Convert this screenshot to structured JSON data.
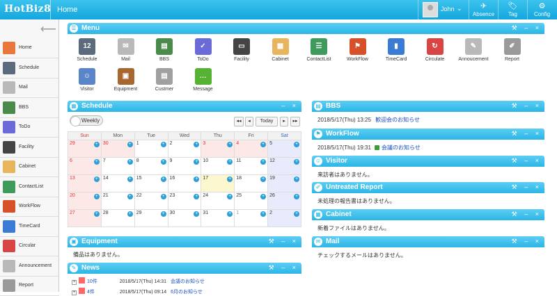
{
  "topbar": {
    "logo": "HotBiz8",
    "home_label": "Home",
    "user_name": "John",
    "buttons": [
      {
        "label": "Absence",
        "icon": "absence-icon",
        "glyph": "✈"
      },
      {
        "label": "Tag",
        "icon": "tag-icon",
        "glyph": "🏷"
      },
      {
        "label": "Config",
        "icon": "config-icon",
        "glyph": "⚙"
      }
    ]
  },
  "sidebar": {
    "items": [
      {
        "label": "Home",
        "icon": "home-icon",
        "color": "#e8783c"
      },
      {
        "label": "Schedule",
        "icon": "schedule-icon",
        "color": "#5b6a7d"
      },
      {
        "label": "Mail",
        "icon": "mail-icon",
        "color": "#b9b9b9"
      },
      {
        "label": "BBS",
        "icon": "bbs-icon",
        "color": "#4a8a4a"
      },
      {
        "label": "ToDo",
        "icon": "todo-icon",
        "color": "#6a6ad8"
      },
      {
        "label": "Facility",
        "icon": "facility-icon",
        "color": "#444444"
      },
      {
        "label": "Cabinet",
        "icon": "cabinet-icon",
        "color": "#e8b55c"
      },
      {
        "label": "ContactList",
        "icon": "contactlist-icon",
        "color": "#3f9b5b"
      },
      {
        "label": "WorkFlow",
        "icon": "workflow-icon",
        "color": "#d8502a"
      },
      {
        "label": "TimeCard",
        "icon": "timecard-icon",
        "color": "#3a7bd5"
      },
      {
        "label": "Circular",
        "icon": "circular-icon",
        "color": "#d94545"
      },
      {
        "label": "Announcement",
        "icon": "announcement-icon",
        "color": "#b9b9b9"
      },
      {
        "label": "Report",
        "icon": "report-icon",
        "color": "#9a9a9a"
      }
    ]
  },
  "menu_panel": {
    "title": "Menu",
    "items": [
      {
        "label": "Schedule",
        "icon": "schedule-icon",
        "color": "#5b6a7d",
        "glyph": "12"
      },
      {
        "label": "Mail",
        "icon": "mail-icon",
        "color": "#b9b9b9",
        "glyph": "✉"
      },
      {
        "label": "BBS",
        "icon": "bbs-icon",
        "color": "#4a8a4a",
        "glyph": "▤"
      },
      {
        "label": "ToDo",
        "icon": "todo-icon",
        "color": "#6a6ad8",
        "glyph": "✓"
      },
      {
        "label": "Facility",
        "icon": "facility-icon",
        "color": "#444444",
        "glyph": "▭"
      },
      {
        "label": "Cabinet",
        "icon": "cabinet-icon",
        "color": "#e8b55c",
        "glyph": "▦"
      },
      {
        "label": "ContactList",
        "icon": "contactlist-icon",
        "color": "#3f9b5b",
        "glyph": "☰"
      },
      {
        "label": "WorkFlow",
        "icon": "workflow-icon",
        "color": "#d8502a",
        "glyph": "⚑"
      },
      {
        "label": "TimeCard",
        "icon": "timecard-icon",
        "color": "#3a7bd5",
        "glyph": "▮"
      },
      {
        "label": "Circulate",
        "icon": "circulate-icon",
        "color": "#d94545",
        "glyph": "↻"
      },
      {
        "label": "Annoucement",
        "icon": "announcement-icon",
        "color": "#b9b9b9",
        "glyph": "✎"
      },
      {
        "label": "Report",
        "icon": "report-icon",
        "color": "#9a9a9a",
        "glyph": "✐"
      },
      {
        "label": "Visitor",
        "icon": "visitor-icon",
        "color": "#5a86c9",
        "glyph": "☺"
      },
      {
        "label": "Equipment",
        "icon": "equipment-icon",
        "color": "#a8672e",
        "glyph": "▣"
      },
      {
        "label": "Custmer",
        "icon": "customer-icon",
        "color": "#a0a0a0",
        "glyph": "▤"
      },
      {
        "label": "Message",
        "icon": "message-icon",
        "color": "#56b232",
        "glyph": "…"
      }
    ]
  },
  "schedule_panel": {
    "title": "Schedule",
    "weekly_label": "Weekly",
    "nav": {
      "prev2": "◂◂",
      "prev": "◂",
      "today": "Today",
      "next": "▸",
      "next2": "▸▸"
    },
    "weekdays": [
      "Sun",
      "Mon",
      "Tue",
      "Wed",
      "Thu",
      "Fri",
      "Sat"
    ],
    "weeks": [
      [
        "29",
        "30",
        "1",
        "2",
        "3",
        "4",
        "5"
      ],
      [
        "6",
        "7",
        "8",
        "9",
        "10",
        "11",
        "12"
      ],
      [
        "13",
        "14",
        "15",
        "16",
        "17",
        "18",
        "19"
      ],
      [
        "20",
        "21",
        "22",
        "23",
        "24",
        "25",
        "26"
      ],
      [
        "27",
        "28",
        "29",
        "30",
        "31",
        "1",
        "2"
      ]
    ],
    "holidays": [
      "3",
      "4",
      "5",
      "6"
    ],
    "today": "17"
  },
  "equipment_panel": {
    "title": "Equipment",
    "text": "備品はありません。"
  },
  "news_panel": {
    "title": "News",
    "rows": [
      {
        "count": "10件",
        "date": "2018/5/17(Thu) 14:31",
        "link": "会議のお知らせ"
      },
      {
        "count": "4件",
        "date": "2018/5/17(Thu) 09:14",
        "link": "6月のお知らせ"
      }
    ]
  },
  "bbs_panel": {
    "title": "BBS",
    "date": "2018/5/17(Thu) 13:25",
    "link": "歓迎会のお知らせ"
  },
  "workflow_panel": {
    "title": "WorkFlow",
    "date": "2018/5/17(Thu) 19:31",
    "link": "会議のお知らせ"
  },
  "visitor_panel": {
    "title": "Visitor",
    "text": "来訪者はありません。"
  },
  "report_panel": {
    "title": "Untreated Report",
    "text": "未処理の報告書はありません。"
  },
  "cabinet_panel": {
    "title": "Cabinet",
    "text": "新着ファイルはありません。"
  },
  "mail_panel": {
    "title": "Mail",
    "text": "チェックするメールはありません。"
  },
  "panel_controls": "⚒ – ×"
}
